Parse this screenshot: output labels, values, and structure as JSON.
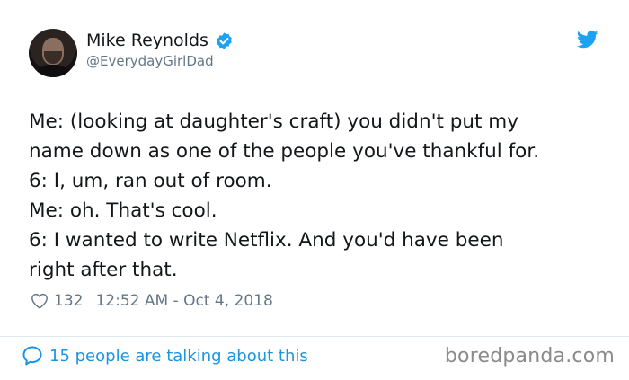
{
  "author": {
    "display_name": "Mike Reynolds",
    "handle": "@EverydayGirlDad",
    "verified": true
  },
  "tweet": {
    "text": "Me: (looking at daughter's craft) you didn't put my\nname down as one of the people you've thankful for.\n6: I, um, ran out of room.\nMe: oh. That's cool.\n6: I wanted to write Netflix. And you'd have been\nright after that."
  },
  "meta": {
    "like_count": "132",
    "timestamp": "12:52 AM - Oct 4, 2018"
  },
  "footer": {
    "talking_label": "15 people are talking about this"
  },
  "watermark": "boredpanda.com",
  "icons": {
    "brand": "twitter-bird-icon",
    "verified": "verified-badge-icon",
    "like": "heart-icon",
    "reply": "speech-bubble-icon"
  },
  "colors": {
    "text_primary": "#14171a",
    "text_secondary": "#657786",
    "accent": "#1da1f2",
    "link": "#1b95e0",
    "divider": "#e1e8ed",
    "watermark": "#8a8a8a"
  }
}
